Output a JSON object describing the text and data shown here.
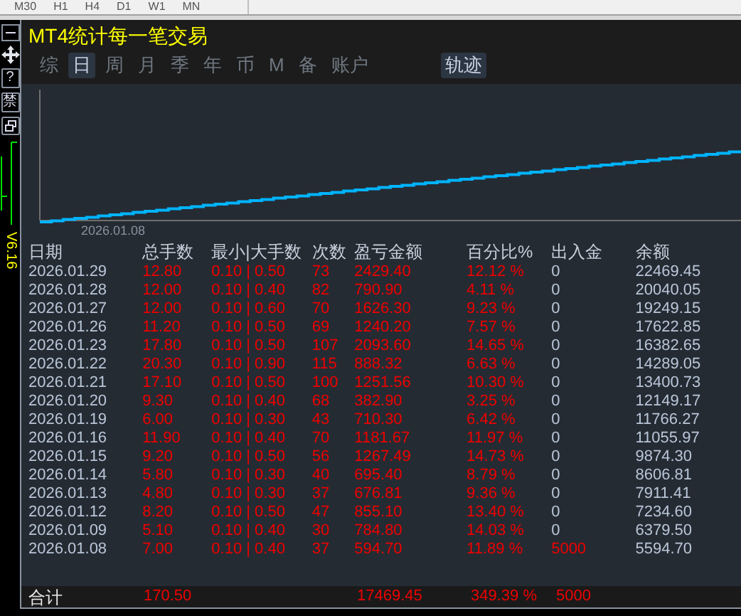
{
  "toolbar": {
    "timeframes": [
      "M30",
      "H1",
      "H4",
      "D1",
      "W1",
      "MN"
    ]
  },
  "side_buttons": [
    {
      "kind": "minus"
    },
    {
      "kind": "move"
    },
    {
      "kind": "help",
      "label": "?"
    },
    {
      "kind": "text",
      "label": "禁"
    },
    {
      "kind": "restore"
    }
  ],
  "side_label": "V6.16",
  "title": "MT4统计每一笔交易",
  "tabs": [
    {
      "label": "综",
      "selected": false
    },
    {
      "label": "日",
      "selected": true
    },
    {
      "label": "周",
      "selected": false
    },
    {
      "label": "月",
      "selected": false
    },
    {
      "label": "季",
      "selected": false
    },
    {
      "label": "年",
      "selected": false
    },
    {
      "label": "币",
      "selected": false
    },
    {
      "label": "M",
      "selected": false
    },
    {
      "label": "备",
      "selected": false
    },
    {
      "label": "账户",
      "selected": false
    }
  ],
  "track_tab": {
    "label": "轨迹",
    "selected": true
  },
  "chart": {
    "x_label": "2026.01.08"
  },
  "table": {
    "columns": [
      "日期",
      "总手数",
      "最小|大手数",
      "次数",
      "盈亏金额",
      "百分比%",
      "出入金",
      "余额"
    ],
    "rows": [
      {
        "cells": [
          "2026.01.29",
          "12.80",
          "0.10 | 0.50",
          "73",
          "2429.40",
          "12.12 %",
          "0",
          "22469.45"
        ],
        "deposit_positive": false
      },
      {
        "cells": [
          "2026.01.28",
          "12.00",
          "0.10 | 0.40",
          "82",
          "790.90",
          "4.11 %",
          "0",
          "20040.05"
        ],
        "deposit_positive": false
      },
      {
        "cells": [
          "2026.01.27",
          "12.00",
          "0.10 | 0.60",
          "70",
          "1626.30",
          "9.23 %",
          "0",
          "19249.15"
        ],
        "deposit_positive": false
      },
      {
        "cells": [
          "2026.01.26",
          "11.20",
          "0.10 | 0.50",
          "69",
          "1240.20",
          "7.57 %",
          "0",
          "17622.85"
        ],
        "deposit_positive": false
      },
      {
        "cells": [
          "2026.01.23",
          "17.80",
          "0.10 | 0.50",
          "107",
          "2093.60",
          "14.65 %",
          "0",
          "16382.65"
        ],
        "deposit_positive": false
      },
      {
        "cells": [
          "2026.01.22",
          "20.30",
          "0.10 | 0.90",
          "115",
          "888.32",
          "6.63 %",
          "0",
          "14289.05"
        ],
        "deposit_positive": false
      },
      {
        "cells": [
          "2026.01.21",
          "17.10",
          "0.10 | 0.50",
          "100",
          "1251.56",
          "10.30 %",
          "0",
          "13400.73"
        ],
        "deposit_positive": false
      },
      {
        "cells": [
          "2026.01.20",
          "9.30",
          "0.10 | 0.40",
          "68",
          "382.90",
          "3.25 %",
          "0",
          "12149.17"
        ],
        "deposit_positive": false
      },
      {
        "cells": [
          "2026.01.19",
          "6.00",
          "0.10 | 0.30",
          "43",
          "710.30",
          "6.42 %",
          "0",
          "11766.27"
        ],
        "deposit_positive": false
      },
      {
        "cells": [
          "2026.01.16",
          "11.90",
          "0.10 | 0.40",
          "70",
          "1181.67",
          "11.97 %",
          "0",
          "11055.97"
        ],
        "deposit_positive": false
      },
      {
        "cells": [
          "2026.01.15",
          "9.20",
          "0.10 | 0.50",
          "56",
          "1267.49",
          "14.73 %",
          "0",
          "9874.30"
        ],
        "deposit_positive": false
      },
      {
        "cells": [
          "2026.01.14",
          "5.80",
          "0.10 | 0.30",
          "40",
          "695.40",
          "8.79 %",
          "0",
          "8606.81"
        ],
        "deposit_positive": false
      },
      {
        "cells": [
          "2026.01.13",
          "4.80",
          "0.10 | 0.30",
          "37",
          "676.81",
          "9.36 %",
          "0",
          "7911.41"
        ],
        "deposit_positive": false
      },
      {
        "cells": [
          "2026.01.12",
          "8.20",
          "0.10 | 0.50",
          "47",
          "855.10",
          "13.40 %",
          "0",
          "7234.60"
        ],
        "deposit_positive": false
      },
      {
        "cells": [
          "2026.01.09",
          "5.10",
          "0.10 | 0.40",
          "30",
          "784.80",
          "14.03 %",
          "0",
          "6379.50"
        ],
        "deposit_positive": false
      },
      {
        "cells": [
          "2026.01.08",
          "7.00",
          "0.10 | 0.40",
          "37",
          "594.70",
          "11.89 %",
          "5000",
          "5594.70"
        ],
        "deposit_positive": true
      }
    ],
    "total": {
      "label": "合计",
      "lots": "170.50",
      "pnl": "17469.45",
      "percent": "349.39 %",
      "deposit": "5000"
    }
  }
}
